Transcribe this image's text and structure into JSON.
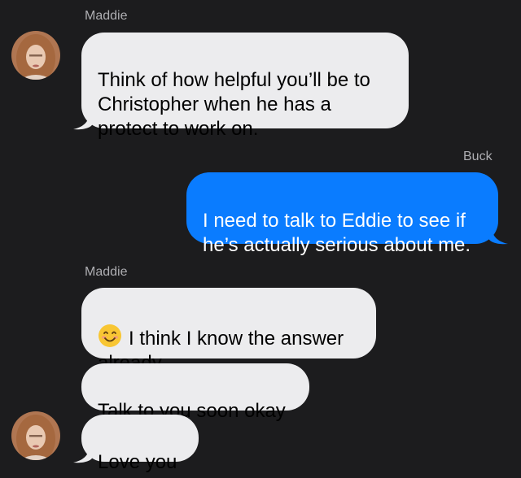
{
  "conversation": {
    "messages": [
      {
        "sender": "Maddie",
        "direction": "incoming",
        "text": "Think of how helpful you’ll be to\nChristopher when he has a\nprotect to work on."
      },
      {
        "sender": "Buck",
        "direction": "outgoing",
        "text": "I need to talk to Eddie to see if\nhe’s actually serious about me."
      },
      {
        "sender": "Maddie",
        "direction": "incoming",
        "emoji": "smiling-face-emoji",
        "text": "I think I know the answer\nalready"
      },
      {
        "sender": "Maddie",
        "direction": "incoming",
        "text": "Talk to you soon okay"
      },
      {
        "sender": "Maddie",
        "direction": "incoming",
        "text": "Love you"
      }
    ]
  },
  "colors": {
    "background": "#1c1c1e",
    "incoming_bubble": "#ececee",
    "outgoing_bubble": "#0a7cff",
    "sender_label": "#aeaeb2"
  }
}
